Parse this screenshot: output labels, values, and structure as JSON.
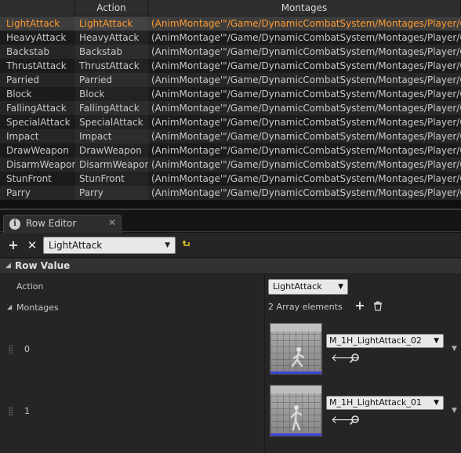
{
  "table": {
    "headers": [
      "",
      "Action",
      "Montages"
    ],
    "rows": [
      {
        "name": "LightAttack",
        "action": "LightAttack",
        "montages": "(AnimMontage'\"/Game/DynamicCombatSystem/Montages/Player/OneHa",
        "selected": true
      },
      {
        "name": "HeavyAttack",
        "action": "HeavyAttack",
        "montages": "(AnimMontage'\"/Game/DynamicCombatSystem/Montages/Player/OneHa"
      },
      {
        "name": "Backstab",
        "action": "Backstab",
        "montages": "(AnimMontage'\"/Game/DynamicCombatSystem/Montages/Player/Comm"
      },
      {
        "name": "ThrustAttack",
        "action": "ThrustAttack",
        "montages": "(AnimMontage'\"/Game/DynamicCombatSystem/Montages/Player/OneHa"
      },
      {
        "name": "Parried",
        "action": "Parried",
        "montages": "(AnimMontage'\"/Game/DynamicCombatSystem/Montages/Player/Comm"
      },
      {
        "name": "Block",
        "action": "Block",
        "montages": "(AnimMontage'\"/Game/DynamicCombatSystem/Montages/Player/OneHa"
      },
      {
        "name": "FallingAttack",
        "action": "FallingAttack",
        "montages": "(AnimMontage'\"/Game/DynamicCombatSystem/Montages/Player/OneHa"
      },
      {
        "name": "SpecialAttack",
        "action": "SpecialAttack",
        "montages": "(AnimMontage'\"/Game/DynamicCombatSystem/Montages/Player/OneHa"
      },
      {
        "name": "Impact",
        "action": "Impact",
        "montages": "(AnimMontage'\"/Game/DynamicCombatSystem/Montages/Player/Comm"
      },
      {
        "name": "DrawWeapon",
        "action": "DrawWeapon",
        "montages": "(AnimMontage'\"/Game/DynamicCombatSystem/Montages/Player/OneHa"
      },
      {
        "name": "DisarmWeapon",
        "action": "DisarmWeapon",
        "montages": "(AnimMontage'\"/Game/DynamicCombatSystem/Montages/Player/OneHa"
      },
      {
        "name": "StunFront",
        "action": "StunFront",
        "montages": "(AnimMontage'\"/Game/DynamicCombatSystem/Montages/Player/OneHa"
      },
      {
        "name": "Parry",
        "action": "Parry",
        "montages": "(AnimMontage'\"/Game/DynamicCombatSystem/Montages/Player/OneHa"
      }
    ],
    "selected_color": "#ff9a2e"
  },
  "tab": {
    "label": "Row Editor",
    "icon": "info-icon",
    "close": "✕"
  },
  "toolbar": {
    "add": "+",
    "remove": "✕",
    "row_select": "LightAttack",
    "reset_icon": "reset-arrow-icon"
  },
  "section": {
    "title": "Row Value"
  },
  "props": {
    "action_label": "Action",
    "action_value": "LightAttack",
    "montages_label": "Montages",
    "array_count": "2 Array elements",
    "elements": [
      {
        "index": "0",
        "asset": "M_1H_LightAttack_02"
      },
      {
        "index": "1",
        "asset": "M_1H_LightAttack_01"
      }
    ]
  }
}
